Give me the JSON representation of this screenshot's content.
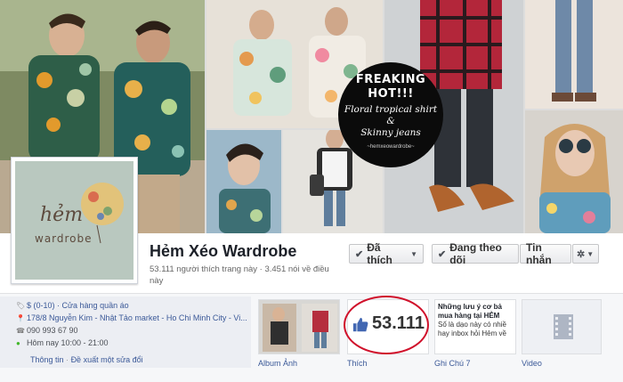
{
  "page": {
    "name": "Hẻm Xéo Wardrobe",
    "stats": "53.111 người thích trang này · 3.451 nói về điều này"
  },
  "cover": {
    "promo": {
      "headline_1": "FREAKING",
      "headline_2": "HOT!!!",
      "line_1": "Floral tropical shirt",
      "line_2": "&",
      "line_3": "Skinny jeans",
      "handle": "~hemxeowardrobe~"
    }
  },
  "profile": {
    "logo_brand": "hẻm",
    "logo_sub": "wardrobe"
  },
  "actions": {
    "liked_label": "Đã thích",
    "following_label": "Đang theo dõi",
    "message_label": "Tin nhắn",
    "settings_caret": "▼"
  },
  "about": {
    "category": "$ (0-10) · Cửa hàng quần áo",
    "address": "178/8 Nguyễn Kim - Nhật Tảo market - Ho Chi Minh City - Vi...",
    "phone": "090 993 67 90",
    "hours": "Hôm nay 10:00 - 21:00",
    "info_link": "Thông tin",
    "sep": "·",
    "suggest_link": "Đề xuất một sửa đổi"
  },
  "apps": {
    "photos_label": "Album Ảnh",
    "likes_label": "Thích",
    "likes_count": "53.111",
    "notes_label": "Ghi Chú",
    "notes_count": "7",
    "notes_preview_title": "Những lưu ý cơ bả mua hàng tại HẺM",
    "notes_preview_body": "Số là dạo này có nhiề hay inbox hỏi Hẻm về",
    "video_label": "Video"
  },
  "colors": {
    "link": "#3b5998",
    "ring": "#d0112b",
    "like_blue": "#4267b2"
  }
}
